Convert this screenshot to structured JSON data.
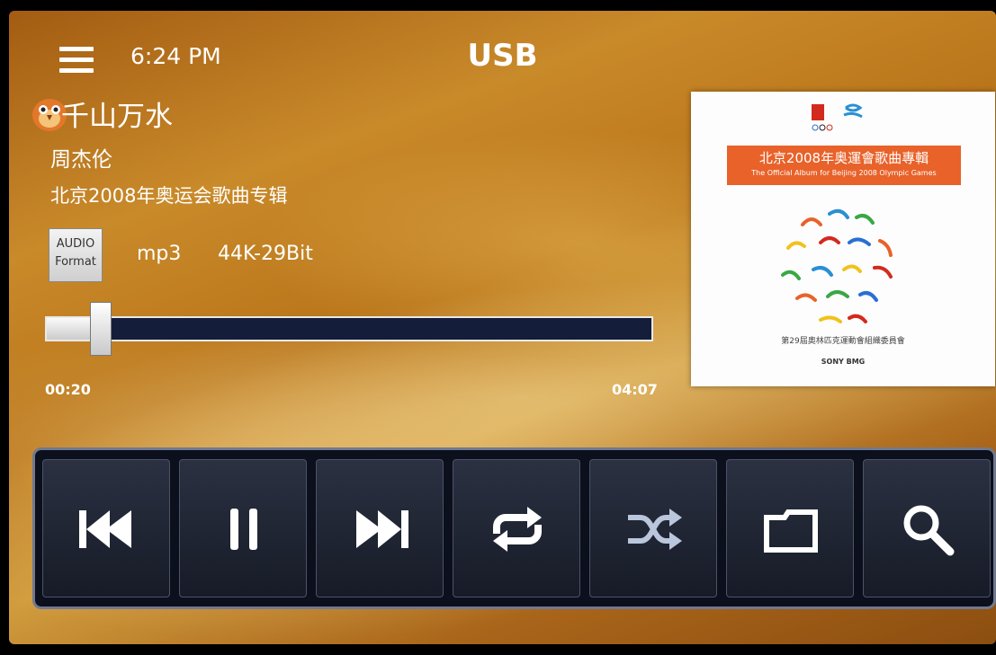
{
  "status_bar": {
    "time": "6:24 PM",
    "source": "USB"
  },
  "track": {
    "title": "千山万水",
    "artist": "周杰伦",
    "album": "北京2008年奥运会歌曲专辑"
  },
  "format": {
    "badge_line1": "AUDIO",
    "badge_line2": "Format",
    "codec": "mp3",
    "bitrate": "44K-29Bit"
  },
  "progress": {
    "elapsed": "00:20",
    "duration": "04:07",
    "fraction": 0.09
  },
  "album_art": {
    "banner_cn": "北京2008年奥運會歌曲專輯",
    "banner_en": "The Official Album for Beijing 2008 Olympic Games",
    "organizer": "第29屆奧林匹克運動會組織委員會",
    "publisher": "SONY BMG"
  },
  "controls": [
    {
      "id": "previous",
      "icon": "previous-track-icon"
    },
    {
      "id": "pause",
      "icon": "pause-icon"
    },
    {
      "id": "next",
      "icon": "next-track-icon"
    },
    {
      "id": "repeat",
      "icon": "repeat-icon"
    },
    {
      "id": "shuffle",
      "icon": "shuffle-icon"
    },
    {
      "id": "folder",
      "icon": "folder-icon"
    },
    {
      "id": "search",
      "icon": "search-icon"
    }
  ],
  "colors": {
    "control_bg": "#171b27",
    "track_bg": "#141d3a",
    "banner": "#e8622a"
  }
}
